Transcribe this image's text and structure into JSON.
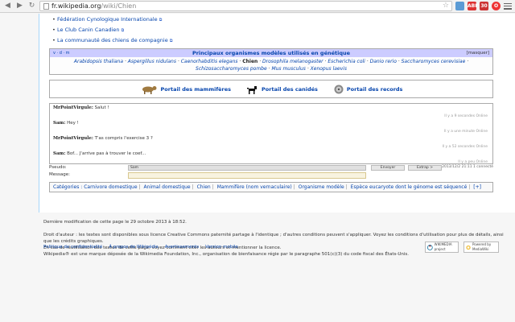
{
  "browser": {
    "url_host": "fr.wikipedia.org",
    "url_path": "/wiki/Chien",
    "ext_abp": "ABP",
    "ext_count": "30"
  },
  "external_links": [
    "Fédération Cynologique Internationale",
    "Le Club Canin Canadien",
    "La communauté des chiens de compagnie"
  ],
  "navbox": {
    "vde": "v · d · m",
    "title": "Principaux organismes modèles utilisés en génétique",
    "hide": "[masquer]",
    "items": [
      "Arabidopsis thaliana",
      "Aspergillus nidulans",
      "Caenorhabditis elegans",
      "Chien",
      "Drosophila melanogaster",
      "Escherichia coli",
      "Danio rerio",
      "Saccharomyces cerevisiae",
      "Schizosaccharomyces pombe",
      "Mus musculus",
      "Xenopus laevis"
    ]
  },
  "portals": [
    {
      "label": "Portail des mammifères",
      "icon": "mammal-icon"
    },
    {
      "label": "Portail des canidés",
      "icon": "dog-icon"
    },
    {
      "label": "Portail des records",
      "icon": "record-icon"
    }
  ],
  "chat": {
    "messages": [
      {
        "user": "MrPointVirgule:",
        "text": "Salut !",
        "meta": "Il y a 9 secondes Online"
      },
      {
        "user": "Sam:",
        "text": "Hey !",
        "meta": "Il y a une minute Online"
      },
      {
        "user": "MrPointVirgule:",
        "text": "T'as compris l'exercise 3 ?",
        "meta": "Il y a 52 secondes Online"
      },
      {
        "user": "Sam:",
        "text": "Bof... J'arrive pas à trouver le coef...",
        "meta": "Il y a peu Online"
      }
    ],
    "pseudo_label": "Pseudo:",
    "pseudo_value": "Sam",
    "message_label": "Message:",
    "send_button": "Envoyer",
    "extras_button": "Extrap >",
    "date_stamp": "2013/12/2 21:11 1 connecté"
  },
  "categories": {
    "label": "Catégories :",
    "items": [
      "Carnivore domestique",
      "Animal domestique",
      "Chien",
      "Mammifère (nom vernaculaire)",
      "Organisme modèle",
      "Espèce eucaryote dont le génome est séquencé"
    ],
    "add": "[+]"
  },
  "footer": {
    "modified": "Dernière modification de cette page le 29 octobre 2013 à 18:52.",
    "license_1": "Droit d'auteur : les textes sont disponibles sous licence Creative Commons paternité partage à l'identique ; d'autres conditions peuvent s'appliquer. Voyez les conditions d'utilisation pour plus de détails, ainsi que les crédits graphiques.",
    "license_2": "En cas de réutilisation des textes de cette page, voyez comment citer les auteurs et mentionner la licence.",
    "license_3": "Wikipedia® est une marque déposée de la Wikimedia Foundation, Inc., organisation de bienfaisance régie par le paragraphe 501(c)(3) du code fiscal des États-Unis.",
    "links": [
      "Politique de confidentialité",
      "À propos de Wikipédia",
      "Avertissements",
      "Version mobile"
    ],
    "logo_wikimedia": "WIKIMEDIA project",
    "logo_mediawiki": "Powered by MediaWiki"
  }
}
